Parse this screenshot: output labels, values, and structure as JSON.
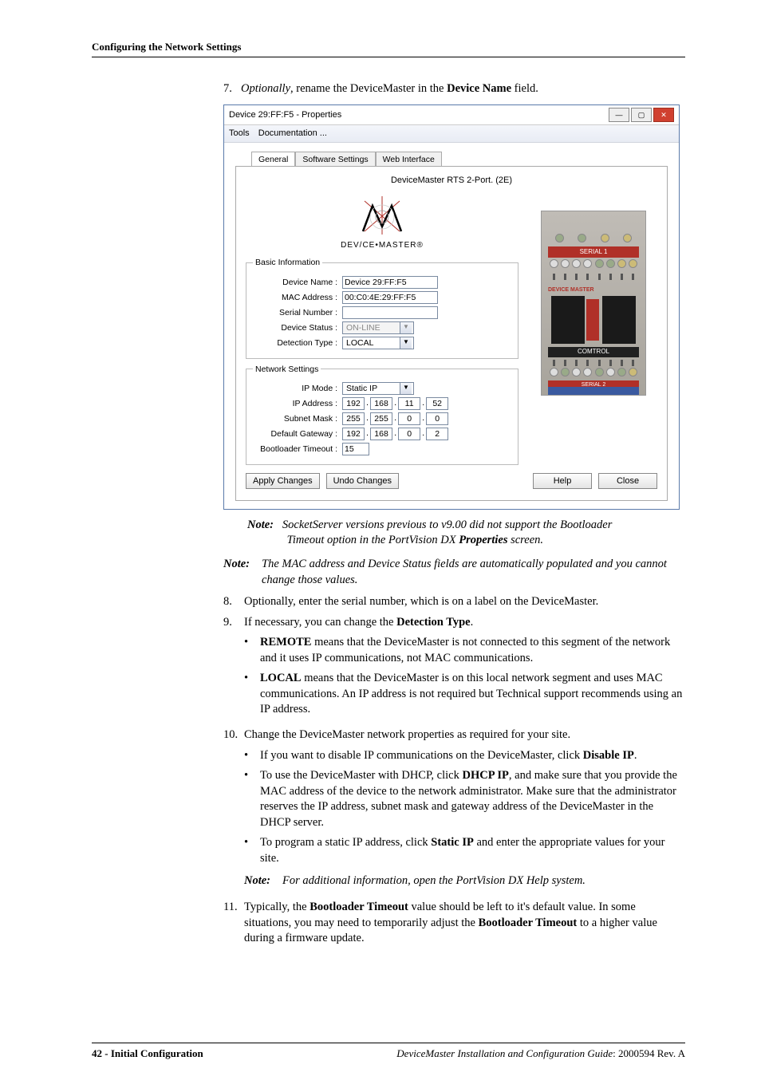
{
  "header_section": "Configuring the Network Settings",
  "step7": {
    "num": "7.",
    "prefix": "Optionally",
    "mid": ", rename the DeviceMaster in the ",
    "field": "Device Name",
    "suffix": " field."
  },
  "dialog": {
    "title": "Device 29:FF:F5 - Properties",
    "menu": {
      "tools": "Tools",
      "documentation": "Documentation ..."
    },
    "tabs": {
      "general": "General",
      "software": "Software Settings",
      "web": "Web Interface"
    },
    "device_title": "DeviceMaster RTS 2-Port. (2E)",
    "logo_text": "DEV/CE•MASTER®",
    "basic": {
      "legend": "Basic Information",
      "device_name_label": "Device Name :",
      "device_name": "Device 29:FF:F5",
      "mac_label": "MAC Address :",
      "mac": "00:C0:4E:29:FF:F5",
      "serial_label": "Serial Number :",
      "serial": "",
      "status_label": "Device Status :",
      "status": "ON-LINE",
      "detection_label": "Detection Type :",
      "detection": "LOCAL"
    },
    "network": {
      "legend": "Network Settings",
      "ipmode_label": "IP Mode :",
      "ipmode": "Static IP",
      "ipaddr_label": "IP Address :",
      "ip": [
        "192",
        "168",
        "11",
        "52"
      ],
      "mask_label": "Subnet Mask :",
      "mask": [
        "255",
        "255",
        "0",
        "0"
      ],
      "gw_label": "Default Gateway :",
      "gw": [
        "192",
        "168",
        "0",
        "2"
      ],
      "boot_label": "Bootloader Timeout :",
      "boot": "15"
    },
    "img_labels": {
      "serial1": "SERIAL 1",
      "dm": "DEVICE MASTER",
      "comtrol": "COMTROL",
      "serial2": "SERIAL 2"
    },
    "buttons": {
      "apply": "Apply Changes",
      "undo": "Undo Changes",
      "help": "Help",
      "close": "Close"
    }
  },
  "note1": {
    "label": "Note:",
    "line1": "SocketServer versions previous to v9.00 did not support the Bootloader",
    "line2": "Timeout option in the PortVision DX ",
    "bold": "Properties",
    "line3": " screen."
  },
  "note2": {
    "label": "Note:",
    "text": "The MAC address and Device Status fields are automatically populated and you cannot change those values."
  },
  "step8": {
    "num": "8.",
    "text": "Optionally, enter the serial number, which is on a label on the DeviceMaster."
  },
  "step9": {
    "num": "9.",
    "text_pre": "If necessary, you can change the ",
    "bold": "Detection Type",
    "text_post": ".",
    "b1_bold": "REMOTE",
    "b1_text": " means that the DeviceMaster is not connected to this segment of the network and it uses IP communications, not MAC communications.",
    "b2_bold": "LOCAL",
    "b2_text": " means that the DeviceMaster is on this local network segment and uses MAC communications. An IP address is not required but Technical support recommends using an IP address."
  },
  "step10": {
    "num": "10.",
    "text": "Change the DeviceMaster network properties as required for your site.",
    "b1_pre": "If you want to disable IP communications on the DeviceMaster, click ",
    "b1_bold": "Disable IP",
    "b1_post": ".",
    "b2_pre": "To use the DeviceMaster with DHCP, click ",
    "b2_bold": "DHCP IP",
    "b2_post": ", and make sure that you provide the MAC address of the device to the network administrator. Make sure that the administrator reserves the IP address, subnet mask and gateway address of the DeviceMaster in the DHCP server.",
    "b3_pre": "To program a static IP address, click ",
    "b3_bold": "Static IP",
    "b3_post": " and enter the appropriate values for your site.",
    "note_label": "Note:",
    "note_text": "For additional information, open the PortVision DX Help system."
  },
  "step11": {
    "num": "11.",
    "pre": "Typically, the ",
    "b1": "Bootloader Timeout",
    "mid": " value should be left to it's default value. In some situations, you may need to temporarily adjust the ",
    "b2": "Bootloader Timeout",
    "post": " to a higher value during a firmware update."
  },
  "footer": {
    "left_page": "42 - ",
    "left_text": "Initial Configuration",
    "right_italic": "DeviceMaster Installation and Configuration Guide",
    "right_rest": ": 2000594 Rev. A"
  }
}
